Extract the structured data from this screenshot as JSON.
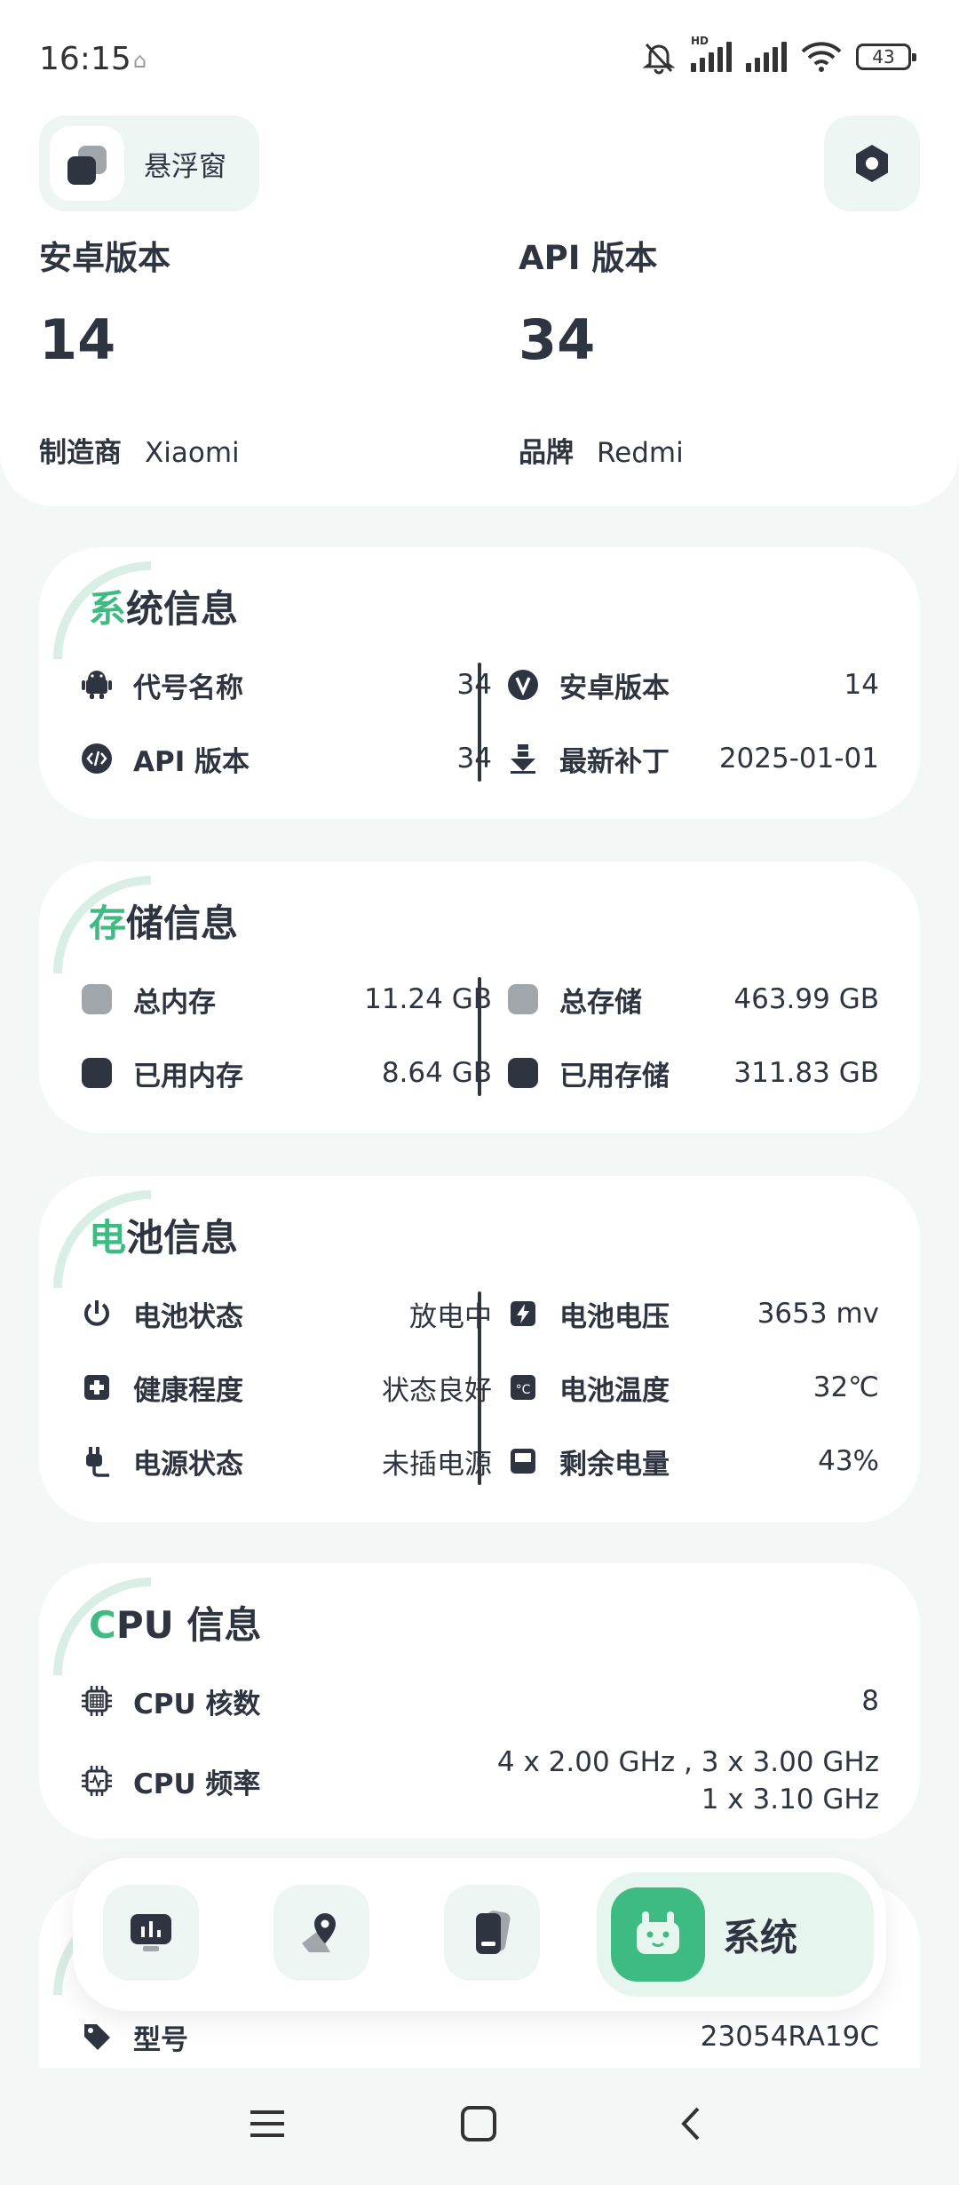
{
  "status_bar": {
    "time": "16:15",
    "hd": "HD",
    "battery": "43"
  },
  "header": {
    "float_label": "悬浮窗",
    "android_version_label": "安卓版本",
    "android_version_value": "14",
    "api_version_label": "API 版本",
    "api_version_value": "34",
    "manufacturer_label": "制造商",
    "manufacturer_value": "Xiaomi",
    "brand_label": "品牌",
    "brand_value": "Redmi"
  },
  "system_info": {
    "title_first": "系",
    "title_rest": "统信息",
    "rows": [
      {
        "label": "代号名称",
        "value": "34",
        "icon": "android-icon"
      },
      {
        "label": "API 版本",
        "value": "34",
        "icon": "code-icon"
      },
      {
        "label": "安卓版本",
        "value": "14",
        "icon": "v-icon"
      },
      {
        "label": "最新补丁",
        "value": "2025-01-01",
        "icon": "download-icon"
      }
    ]
  },
  "storage_info": {
    "title_first": "存",
    "title_rest": "储信息",
    "rows": [
      {
        "label": "总内存",
        "value": "11.24 GB"
      },
      {
        "label": "已用内存",
        "value": "8.64 GB"
      },
      {
        "label": "总存储",
        "value": "463.99 GB"
      },
      {
        "label": "已用存储",
        "value": "311.83 GB"
      }
    ]
  },
  "battery_info": {
    "title_first": "电",
    "title_rest": "池信息",
    "rows": [
      {
        "label": "电池状态",
        "value": "放电中",
        "icon": "power-icon"
      },
      {
        "label": "健康程度",
        "value": "状态良好",
        "icon": "health-icon"
      },
      {
        "label": "电源状态",
        "value": "未插电源",
        "icon": "plug-icon"
      },
      {
        "label": "电池电压",
        "value": "3653 mv",
        "icon": "voltage-icon"
      },
      {
        "label": "电池温度",
        "value": "32℃",
        "icon": "temperature-icon"
      },
      {
        "label": "剩余电量",
        "value": "43%",
        "icon": "battery-level-icon"
      }
    ]
  },
  "cpu_info": {
    "title_first": "C",
    "title_rest": "PU 信息",
    "cores_label": "CPU 核数",
    "cores_value": "8",
    "freq_label": "CPU 频率",
    "freq_line1": "4 x 2.00 GHz , 3 x 3.00 GHz",
    "freq_line2": "1 x 3.10 GHz"
  },
  "device_info_partial": {
    "model_label": "型号",
    "model_value": "23054RA19C"
  },
  "bottom_nav": {
    "items": [
      "monitor-icon",
      "location-icon",
      "device-icon"
    ],
    "active_label": "系统"
  },
  "colors": {
    "accent": "#3EBB82",
    "text": "#2E3440",
    "background": "#F3F8F6"
  }
}
